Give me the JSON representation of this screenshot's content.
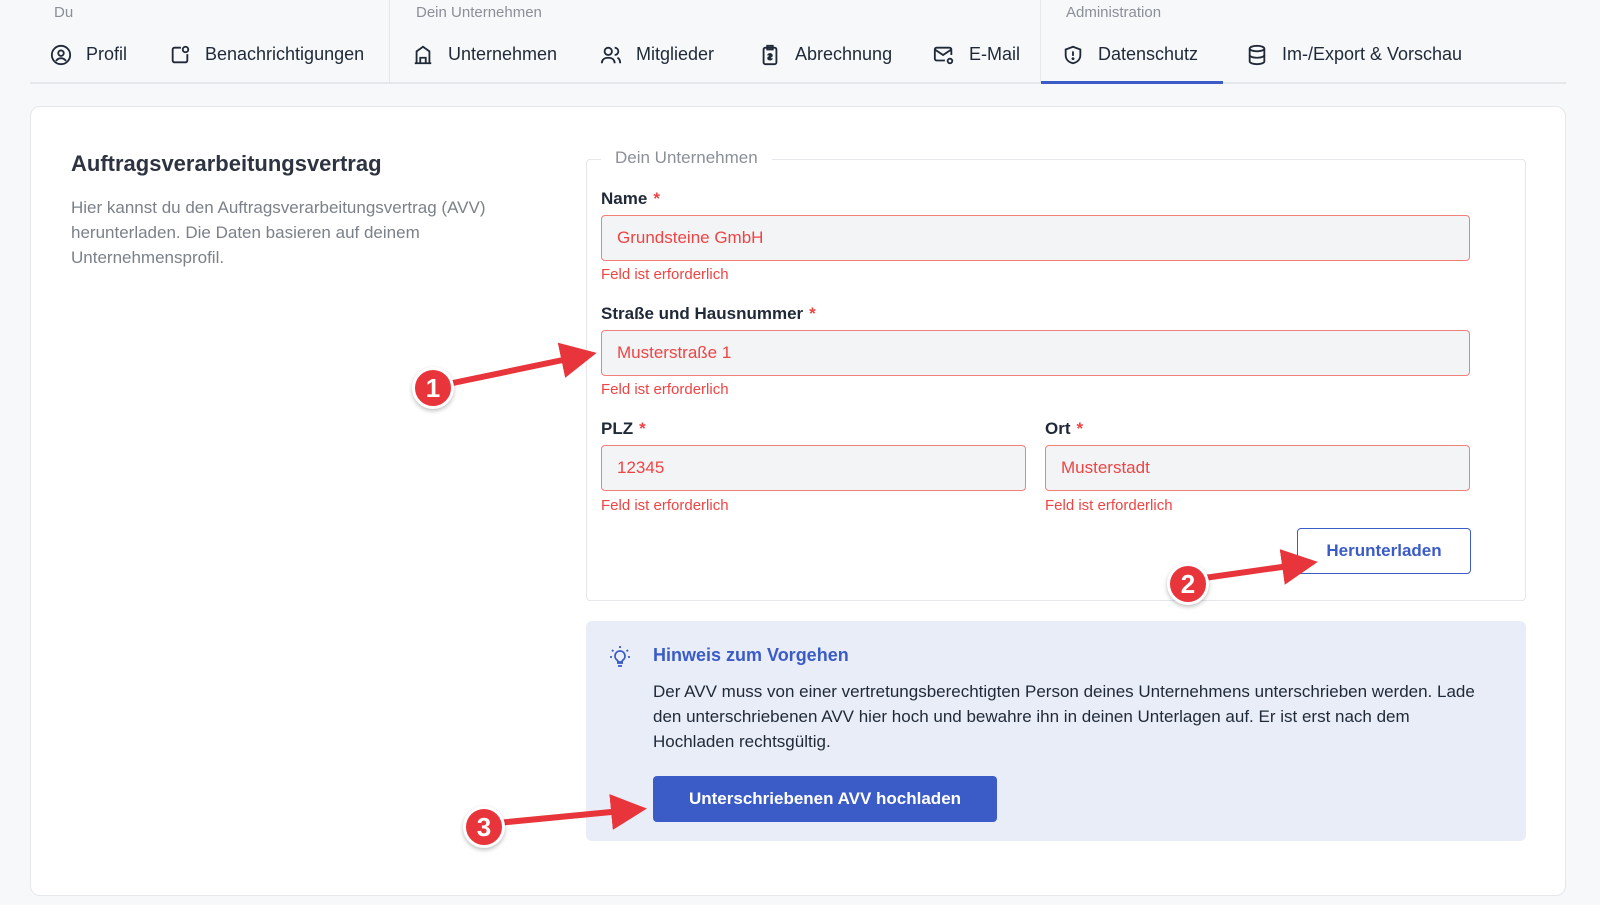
{
  "nav": {
    "groups": [
      {
        "label": "Du",
        "items": [
          {
            "label": "Profil",
            "icon": "user-circle-icon"
          },
          {
            "label": "Benachrichtigungen",
            "icon": "notification-icon"
          }
        ]
      },
      {
        "label": "Dein Unternehmen",
        "items": [
          {
            "label": "Unternehmen",
            "icon": "building-icon"
          },
          {
            "label": "Mitglieder",
            "icon": "users-icon"
          },
          {
            "label": "Abrechnung",
            "icon": "clipboard-icon"
          },
          {
            "label": "E-Mail",
            "icon": "mail-settings-icon"
          }
        ]
      },
      {
        "label": "Administration",
        "items": [
          {
            "label": "Datenschutz",
            "icon": "shield-icon",
            "active": true
          },
          {
            "label": "Im-/Export & Vorschau",
            "icon": "database-icon"
          }
        ]
      }
    ]
  },
  "section": {
    "title": "Auftragsverarbeitungsvertrag",
    "description": "Hier kannst du den Auftragsverarbeitungsvertrag (AVV) herunterladen. Die Daten basieren auf deinem Unternehmensprofil."
  },
  "form": {
    "legend": "Dein Unternehmen",
    "required_mark": "*",
    "error_text": "Feld ist erforderlich",
    "name": {
      "label": "Name",
      "value": "Grundsteine GmbH"
    },
    "street": {
      "label": "Straße und Hausnummer",
      "value": "Musterstraße 1"
    },
    "zip": {
      "label": "PLZ",
      "value": "12345"
    },
    "city": {
      "label": "Ort",
      "value": "Musterstadt"
    },
    "download_label": "Herunterladen"
  },
  "hint": {
    "icon": "lightbulb-icon",
    "title": "Hinweis zum Vorgehen",
    "text": "Der AVV muss von einer vertretungsberechtigten Person deines Unternehmens unterschrieben werden. Lade den unterschriebenen AVV hier hoch und bewahre ihn in deinen Unterlagen auf. Er ist erst nach dem Hochladen rechtsgültig.",
    "upload_label": "Unterschriebenen AVV hochladen"
  },
  "annotations": {
    "badges": [
      "1",
      "2",
      "3"
    ],
    "color": "#e8353b"
  },
  "colors": {
    "accent": "#3b5bc6",
    "error": "#ef4444",
    "hint_bg": "#e9edf8"
  }
}
